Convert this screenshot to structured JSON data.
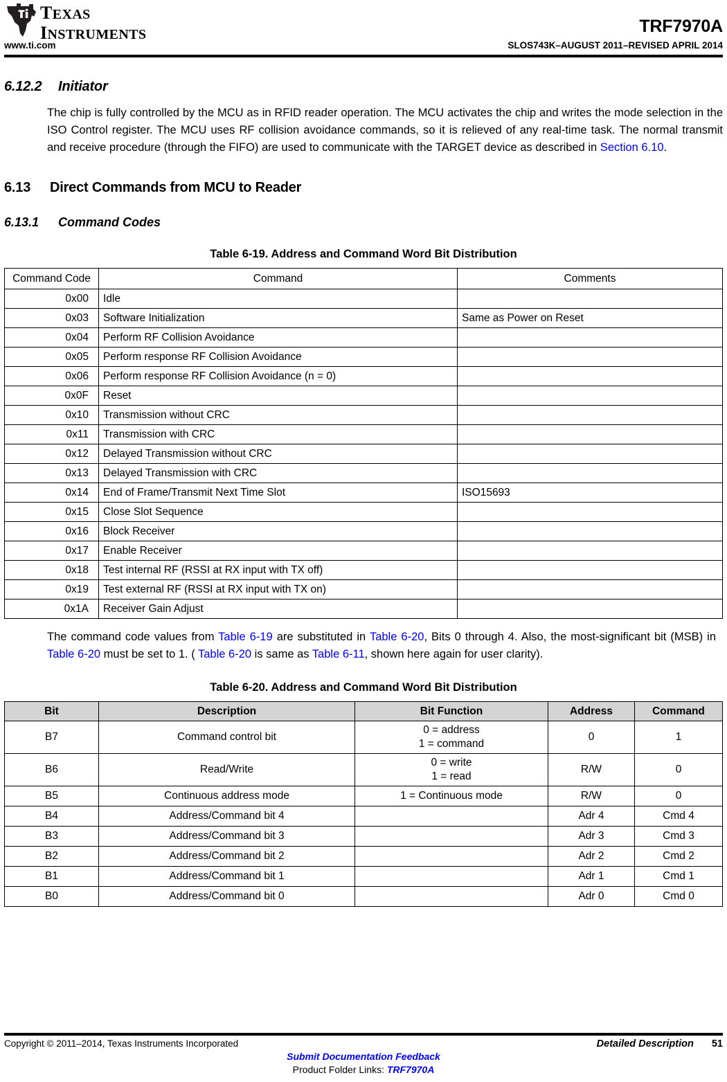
{
  "header": {
    "logo_line1": "TEXAS",
    "logo_line2": "INSTRUMENTS",
    "device": "TRF7970A",
    "website": "www.ti.com",
    "doc_id": "SLOS743K–AUGUST 2011–REVISED APRIL 2014"
  },
  "sections": {
    "s6122_num": "6.12.2",
    "s6122_title": "Initiator",
    "s6122_body_1": "The chip is fully controlled by the MCU as in RFID reader operation. The MCU activates the chip and writes the mode selection in the ISO Control register. The MCU uses RF collision avoidance commands, so it is relieved of any real-time task. The normal transmit and receive procedure (through the FIFO) are used to communicate with the TARGET device as described in ",
    "s6122_link": "Section 6.10",
    "s6122_body_2": ".",
    "s613_num": "6.13",
    "s613_title": "Direct Commands from MCU to Reader",
    "s6131_num": "6.13.1",
    "s6131_title": "Command Codes"
  },
  "table_619": {
    "title": "Table 6-19. Address and Command Word Bit Distribution",
    "headers": [
      "Command Code",
      "Command",
      "Comments"
    ],
    "rows": [
      [
        "0x00",
        "Idle",
        ""
      ],
      [
        "0x03",
        "Software Initialization",
        "Same as Power on Reset"
      ],
      [
        "0x04",
        "Perform RF Collision Avoidance",
        ""
      ],
      [
        "0x05",
        "Perform response RF Collision Avoidance",
        ""
      ],
      [
        "0x06",
        "Perform response RF Collision Avoidance (n = 0)",
        ""
      ],
      [
        "0x0F",
        "Reset",
        ""
      ],
      [
        "0x10",
        "Transmission without CRC",
        ""
      ],
      [
        "0x11",
        "Transmission with CRC",
        ""
      ],
      [
        "0x12",
        "Delayed Transmission without CRC",
        ""
      ],
      [
        "0x13",
        "Delayed Transmission with CRC",
        ""
      ],
      [
        "0x14",
        "End of Frame/Transmit Next Time Slot",
        "ISO15693"
      ],
      [
        "0x15",
        "Close Slot Sequence",
        ""
      ],
      [
        "0x16",
        "Block Receiver",
        ""
      ],
      [
        "0x17",
        "Enable Receiver",
        ""
      ],
      [
        "0x18",
        "Test internal RF (RSSI at RX input with TX off)",
        ""
      ],
      [
        "0x19",
        "Test external RF (RSSI at RX input with TX on)",
        ""
      ],
      [
        "0x1A",
        "Receiver Gain Adjust",
        ""
      ]
    ]
  },
  "midtext": {
    "p1": "The command code values from ",
    "l1": "Table 6-19",
    "p2": " are substituted in ",
    "l2": "Table 6-20",
    "p3": ", Bits 0 through 4. Also, the most-significant bit (MSB) in ",
    "l3": "Table 6-20",
    "p4": " must be set to 1. ( ",
    "l4": "Table 6-20",
    "p5": " is same as ",
    "l5": "Table 6-11",
    "p6": ", shown here again for user clarity)."
  },
  "table_620": {
    "title": "Table 6-20. Address and Command Word Bit Distribution",
    "headers": [
      "Bit",
      "Description",
      "Bit Function",
      "Address",
      "Command"
    ],
    "rows": [
      {
        "bit": "B7",
        "description": "Command control bit",
        "function": "0 = address\n1 = command",
        "address": "0",
        "command": "1"
      },
      {
        "bit": "B6",
        "description": "Read/Write",
        "function": "0 = write\n1 = read",
        "address": "R/W",
        "command": "0"
      },
      {
        "bit": "B5",
        "description": "Continuous address mode",
        "function": "1 = Continuous mode",
        "address": "R/W",
        "command": "0"
      },
      {
        "bit": "B4",
        "description": "Address/Command bit 4",
        "function": "",
        "address": "Adr 4",
        "command": "Cmd 4"
      },
      {
        "bit": "B3",
        "description": "Address/Command bit 3",
        "function": "",
        "address": "Adr 3",
        "command": "Cmd 3"
      },
      {
        "bit": "B2",
        "description": "Address/Command bit 2",
        "function": "",
        "address": "Adr 2",
        "command": "Cmd 2"
      },
      {
        "bit": "B1",
        "description": "Address/Command bit 1",
        "function": "",
        "address": "Adr 1",
        "command": "Cmd 1"
      },
      {
        "bit": "B0",
        "description": "Address/Command bit 0",
        "function": "",
        "address": "Adr 0",
        "command": "Cmd 0"
      }
    ]
  },
  "footer": {
    "copyright": "Copyright © 2011–2014, Texas Instruments Incorporated",
    "chapter": "Detailed Description",
    "page": "51",
    "feedback": "Submit Documentation Feedback",
    "product_links_label": "Product Folder Links: ",
    "product_links_value": "TRF7970A"
  },
  "colors": {
    "link": "#0000ff",
    "header_fill": "#d4d4d4",
    "rule": "#000000"
  }
}
